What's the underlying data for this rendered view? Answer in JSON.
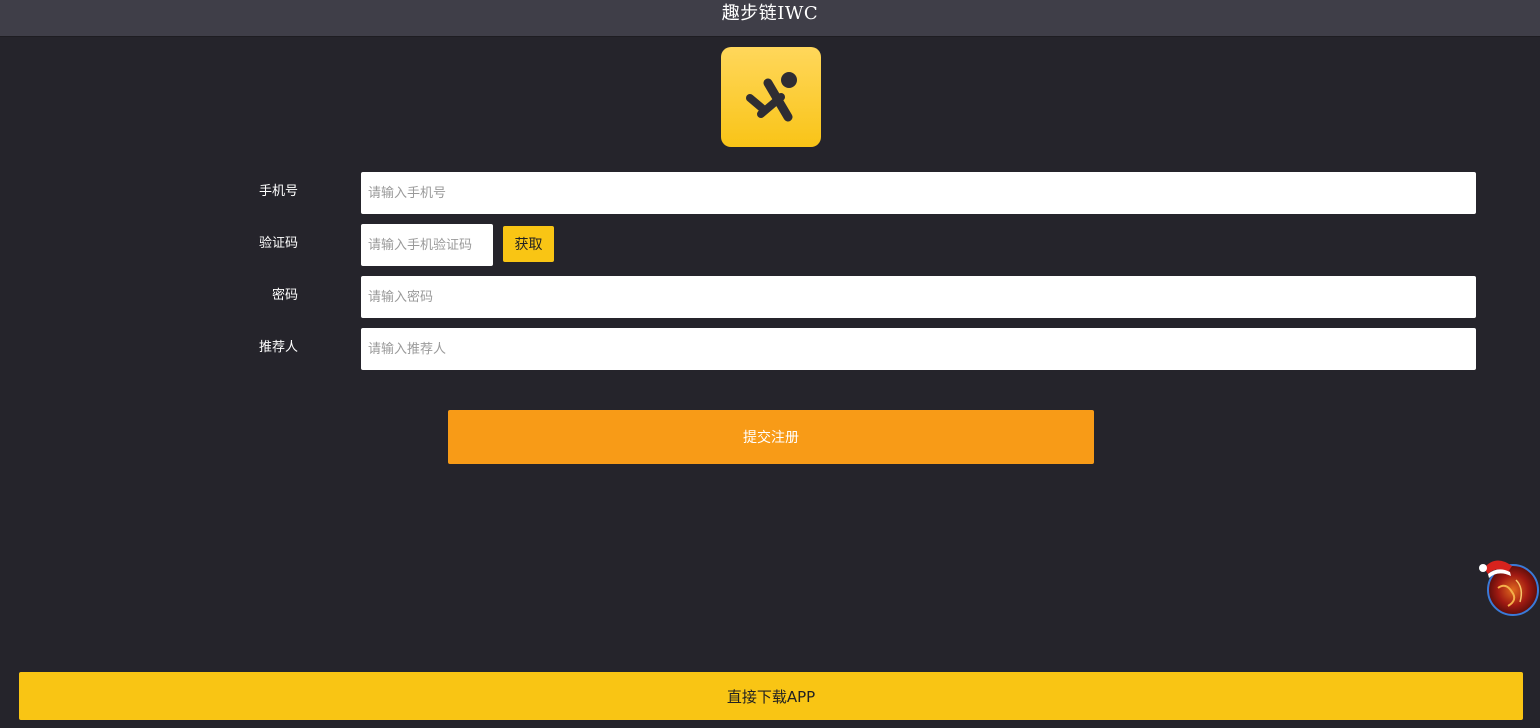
{
  "header": {
    "title": "趣步链IWC"
  },
  "logo": {
    "icon": "running-person-icon",
    "colors": {
      "gradient_top": "#ffd75b",
      "gradient_bottom": "#f9c417",
      "figure": "#2f2d33"
    }
  },
  "form": {
    "phone": {
      "label": "手机号",
      "placeholder": "请输入手机号",
      "value": ""
    },
    "code": {
      "label": "验证码",
      "placeholder": "请输入手机验证码",
      "value": "",
      "get_button": "获取"
    },
    "password": {
      "label": "密码",
      "placeholder": "请输入密码",
      "value": ""
    },
    "referrer": {
      "label": "推荐人",
      "placeholder": "请输入推荐人",
      "value": ""
    },
    "submit_label": "提交注册"
  },
  "footer": {
    "download_label": "直接下载APP"
  },
  "floating": {
    "icon": "santa-hat-avatar-icon"
  },
  "colors": {
    "background": "#25242b",
    "header_bar": "#3f3e48",
    "accent_yellow": "#f9c514",
    "accent_orange": "#f89b17"
  }
}
